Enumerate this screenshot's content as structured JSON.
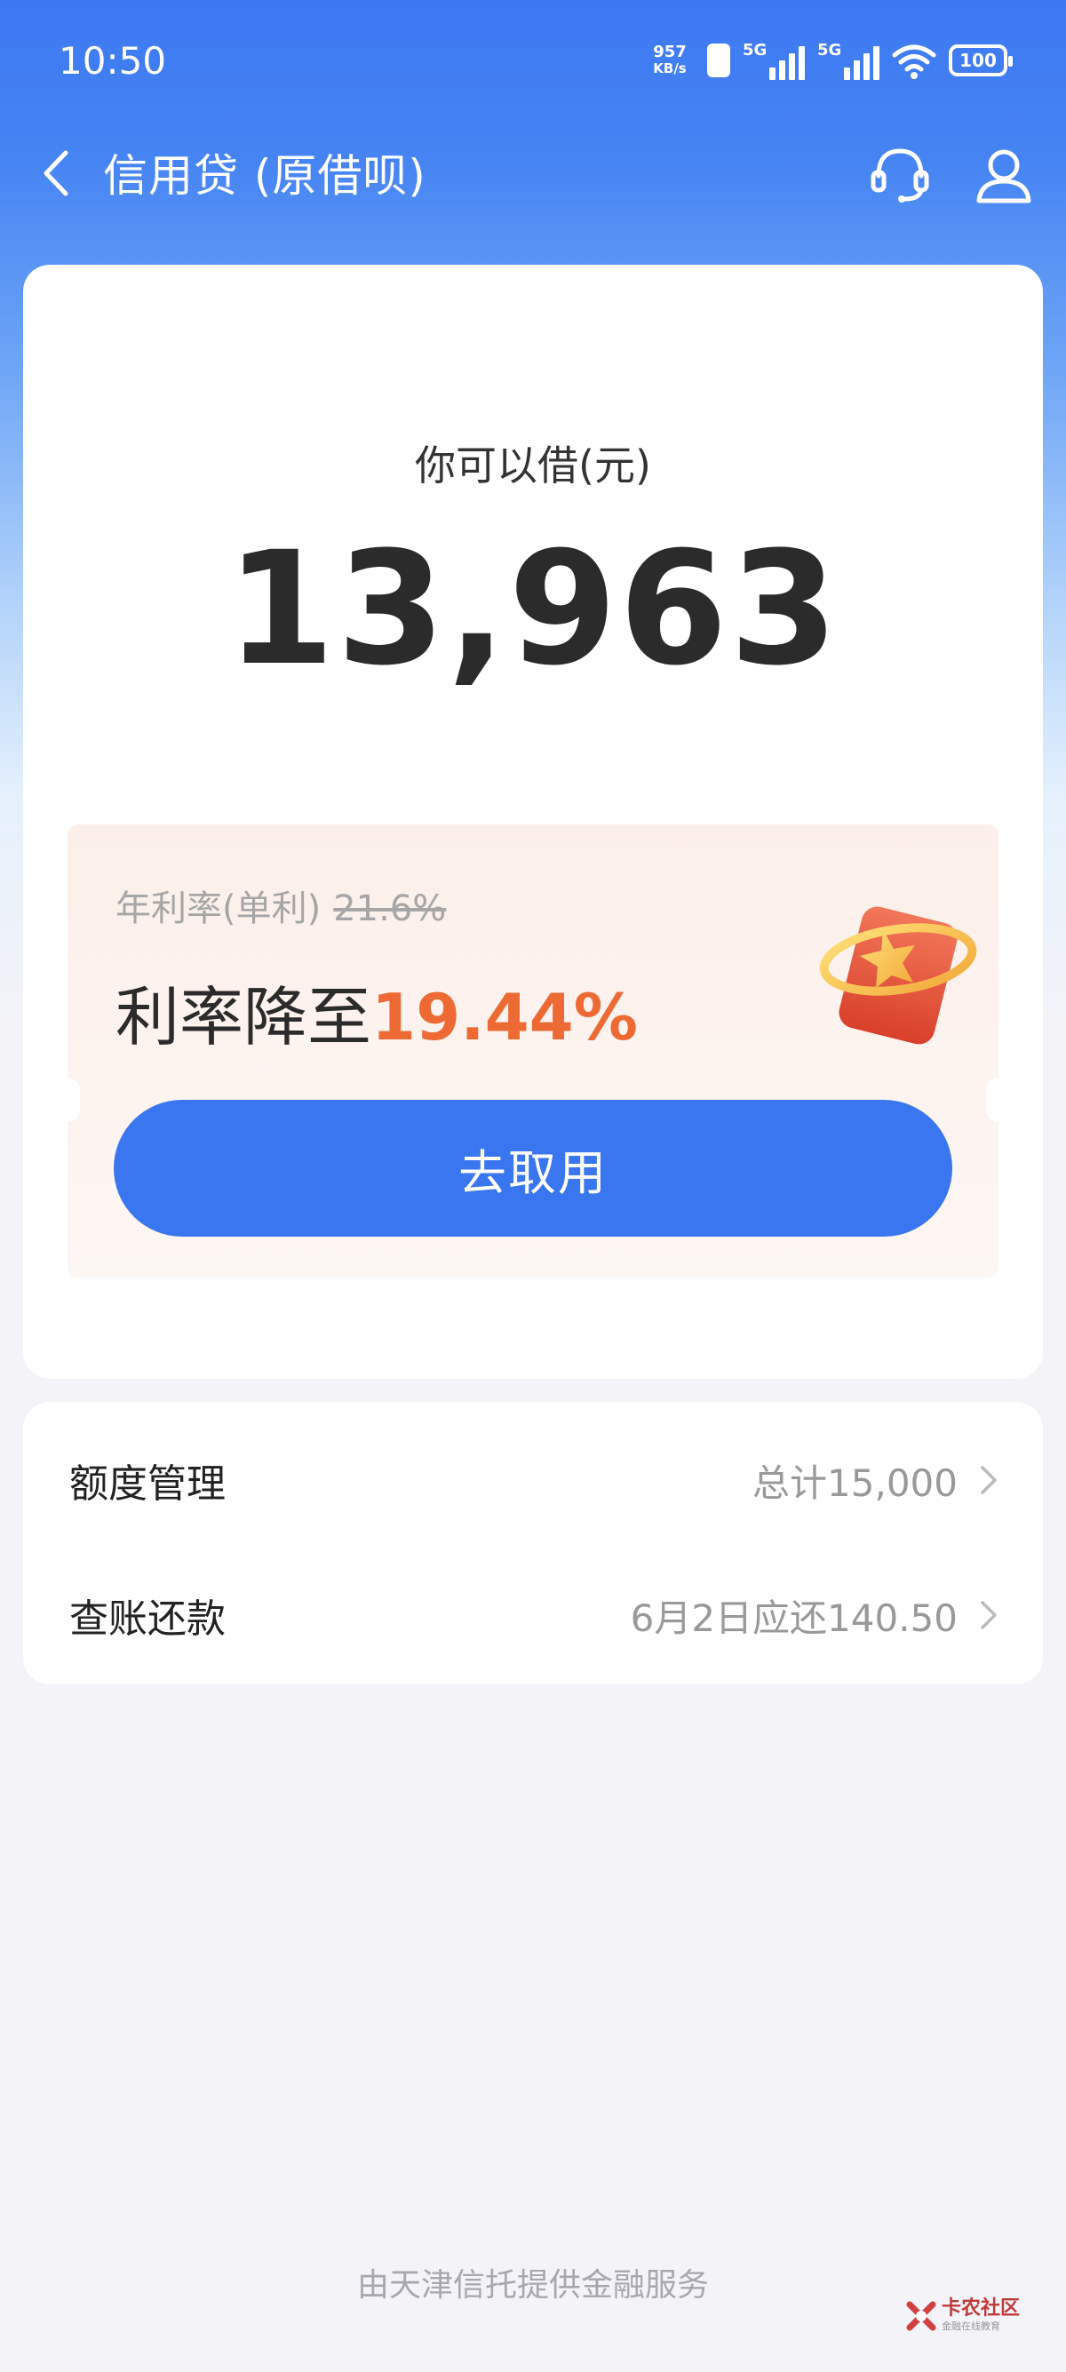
{
  "status_bar": {
    "time": "10:50",
    "net_speed_value": "957",
    "net_speed_unit": "KB/s",
    "signal1_label": "5G",
    "signal2_label": "5G",
    "battery": "100"
  },
  "nav": {
    "title": "信用贷 (原借呗)",
    "icons": [
      "back-icon",
      "customer-service-icon",
      "user-icon"
    ]
  },
  "main": {
    "borrow_label": "你可以借(元)",
    "borrow_amount": "13,963"
  },
  "coupon": {
    "orig_rate_label": "年利率(单利)",
    "orig_rate_value": "21.6%",
    "rate_prefix": "利率降至",
    "rate_new": "19.44%",
    "cta_label": "去取用"
  },
  "menu": {
    "items": [
      {
        "label": "额度管理",
        "value": "总计15,000"
      },
      {
        "label": "查账还款",
        "value": "6月2日应还140.50"
      }
    ]
  },
  "footer": {
    "text": "由天津信托提供金融服务"
  },
  "watermark": {
    "text": "卡农社区",
    "sub": "金融在线教育"
  },
  "colors": {
    "brand_blue": "#3a76ef",
    "rate_orange": "#ee6a34",
    "page_bg": "#f3f3f8"
  }
}
